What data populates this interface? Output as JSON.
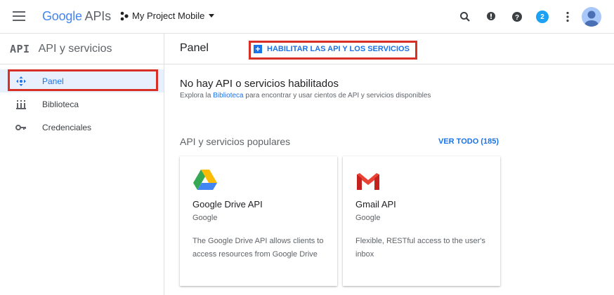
{
  "header": {
    "logo_google": "Google",
    "logo_apis": "APIs",
    "project_name": "My Project Mobile",
    "notification_count": "2"
  },
  "sidebar": {
    "api_mark": "API",
    "title": "API y servicios",
    "items": [
      {
        "label": "Panel",
        "icon": "dashboard-icon",
        "active": true
      },
      {
        "label": "Biblioteca",
        "icon": "library-icon",
        "active": false
      },
      {
        "label": "Credenciales",
        "icon": "key-icon",
        "active": false
      }
    ]
  },
  "main": {
    "title": "Panel",
    "enable_button": "HABILITAR LAS API Y LOS SERVICIOS",
    "empty_title": "No hay API o servicios habilitados",
    "empty_sub_before": "Explora la ",
    "empty_sub_link": "Biblioteca",
    "empty_sub_after": " para encontrar y usar cientos de API y servicios disponibles",
    "popular_title": "API y servicios populares",
    "see_all": "VER TODO (185)",
    "cards": [
      {
        "name": "Google Drive API",
        "publisher": "Google",
        "description": "The Google Drive API allows clients to access resources from Google Drive",
        "icon": "google-drive-icon"
      },
      {
        "name": "Gmail API",
        "publisher": "Google",
        "description": "Flexible, RESTful access to the user's inbox",
        "icon": "gmail-icon"
      }
    ]
  },
  "colors": {
    "accent": "#1a73e8",
    "highlight": "#d93025",
    "active_bg": "#e8f0fe"
  }
}
